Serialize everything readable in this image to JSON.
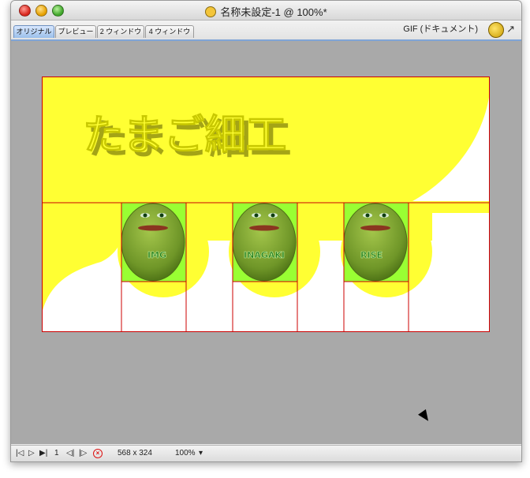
{
  "window": {
    "title": "名称未設定-1 @ 100%*"
  },
  "tabs": [
    {
      "label": "オリジナル",
      "active": true
    },
    {
      "label": "プレビュー",
      "active": false
    },
    {
      "label": "2 ウィンドウ",
      "active": false
    },
    {
      "label": "4 ウィンドウ",
      "active": false
    }
  ],
  "document_type": "GIF (ドキュメント)",
  "canvas": {
    "heading": "たまご細工",
    "eggs": [
      {
        "label": "IMG"
      },
      {
        "label": "INAGAKI"
      },
      {
        "label": "RISE"
      }
    ],
    "colors": {
      "yellow": "#ffff33",
      "egg_green": "#6f9628",
      "slice_green": "#99ff33",
      "slice_line": "#cc0000"
    }
  },
  "statusbar": {
    "frame_number": "1",
    "dimensions": "568 x 324",
    "zoom": "100%"
  },
  "icons": [
    "first-frame-icon",
    "play-icon",
    "next-frame-icon",
    "prev-icon",
    "next-icon",
    "stop-icon",
    "zoom-dropdown-icon"
  ]
}
